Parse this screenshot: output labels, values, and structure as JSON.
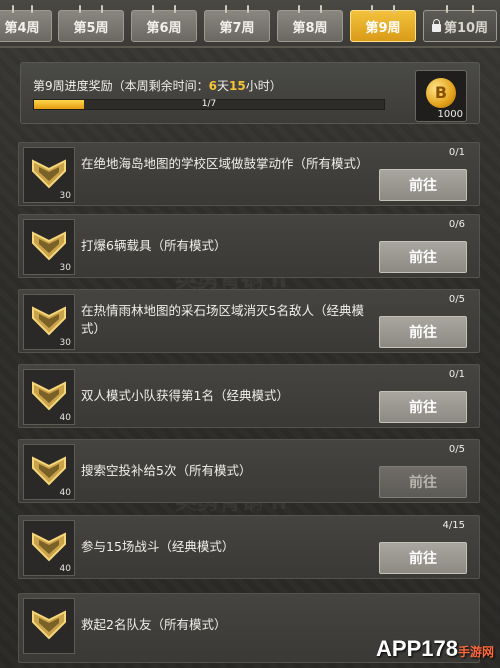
{
  "tabs": [
    {
      "label": "第4周",
      "state": "normal"
    },
    {
      "label": "第5周",
      "state": "normal"
    },
    {
      "label": "第6周",
      "state": "normal"
    },
    {
      "label": "第7周",
      "state": "normal"
    },
    {
      "label": "第8周",
      "state": "normal"
    },
    {
      "label": "第9周",
      "state": "active"
    },
    {
      "label": "第10周",
      "state": "locked",
      "icon": "lock-icon"
    }
  ],
  "progress": {
    "title_prefix": "第9周进度奖励（本周剩余时间：",
    "days": "6",
    "days_unit": "天",
    "hours": "15",
    "hours_unit": "小时）",
    "value": 1,
    "max": 7,
    "text": "1/7"
  },
  "reward": {
    "icon": "coin-icon",
    "count": "1000"
  },
  "tasks": [
    {
      "desc": "在绝地海岛地图的学校区域做鼓掌动作（所有模式）",
      "level": "30",
      "count": "0/1",
      "button": "前往"
    },
    {
      "desc": "打爆6辆载具（所有模式）",
      "level": "30",
      "count": "0/6",
      "button": "前往"
    },
    {
      "desc": "在热情雨林地图的采石场区域消灭5名敌人（经典模式）",
      "level": "30",
      "count": "0/5",
      "button": "前往"
    },
    {
      "desc": "双人模式小队获得第1名（经典模式）",
      "level": "40",
      "count": "0/1",
      "button": "前往"
    },
    {
      "desc": "搜索空投补给5次（所有模式）",
      "level": "40",
      "count": "0/5",
      "button": "前往"
    },
    {
      "desc": "参与15场战斗（经典模式）",
      "level": "40",
      "count": "4/15",
      "button": "前往"
    },
    {
      "desc": "救起2名队友（所有模式）",
      "level": "",
      "count": "",
      "button": ""
    }
  ],
  "watermarks": [
    "英勇青铜 II",
    "英勇青铜 II"
  ],
  "brand": {
    "text": "APP178",
    "site": "手游网"
  },
  "colors": {
    "accent": "#f6c436",
    "active_tab": "#e9b02a"
  }
}
